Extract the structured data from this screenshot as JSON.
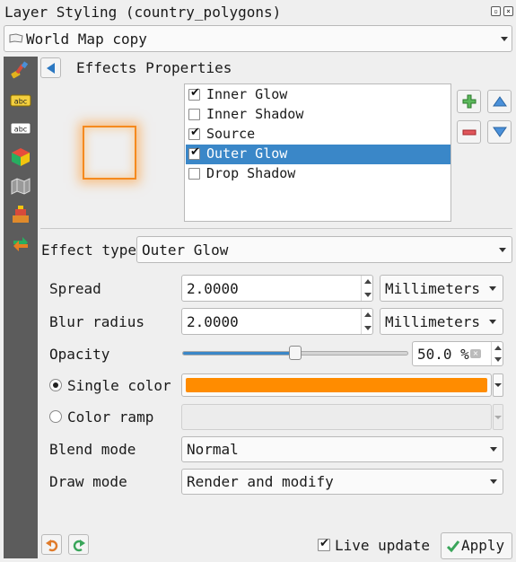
{
  "window": {
    "title": "Layer Styling (country_polygons)"
  },
  "layer_selector": {
    "value": "World Map copy"
  },
  "panel": {
    "title": "Effects Properties"
  },
  "effects": [
    {
      "label": "Inner Glow",
      "checked": true,
      "selected": false
    },
    {
      "label": "Inner Shadow",
      "checked": false,
      "selected": false
    },
    {
      "label": "Source",
      "checked": true,
      "selected": false
    },
    {
      "label": "Outer Glow",
      "checked": true,
      "selected": true
    },
    {
      "label": "Drop Shadow",
      "checked": false,
      "selected": false
    }
  ],
  "effect_type": {
    "label": "Effect type",
    "value": "Outer Glow"
  },
  "spread": {
    "label": "Spread",
    "value": "2.0000",
    "unit": "Millimeters"
  },
  "blur": {
    "label": "Blur radius",
    "value": "2.0000",
    "unit": "Millimeters"
  },
  "opacity": {
    "label": "Opacity",
    "value_text": "50.0 %",
    "percent": 50
  },
  "single_color": {
    "label": "Single color",
    "selected": true,
    "color": "#ff8c00"
  },
  "color_ramp": {
    "label": "Color ramp",
    "selected": false
  },
  "blend_mode": {
    "label": "Blend mode",
    "value": "Normal"
  },
  "draw_mode": {
    "label": "Draw mode",
    "value": "Render and modify"
  },
  "footer": {
    "live_update_label": "Live update",
    "live_update_checked": true,
    "apply_label": "Apply"
  },
  "colors": {
    "accent": "#3a87c8",
    "sidebar": "#5c5c5c",
    "glow": "#f58a1f"
  }
}
